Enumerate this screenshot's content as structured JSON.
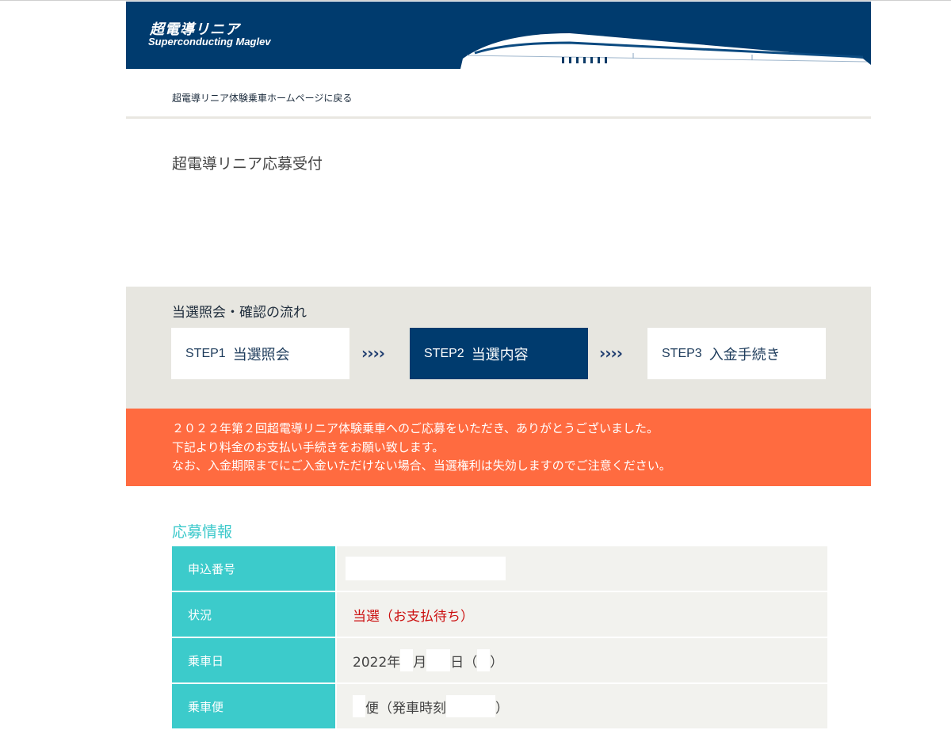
{
  "header": {
    "logo_ja": "超電導リニア",
    "logo_en": "Superconducting Maglev",
    "back_link": "超電導リニア体験乗車ホームページに戻る"
  },
  "page_title": "超電導リニア応募受付",
  "steps": {
    "heading": "当選照会・確認の流れ",
    "arrows": "››››",
    "items": [
      {
        "no": "STEP1",
        "label": "当選照会",
        "active": false
      },
      {
        "no": "STEP2",
        "label": "当選内容",
        "active": true
      },
      {
        "no": "STEP3",
        "label": "入金手続き",
        "active": false
      }
    ]
  },
  "notice": {
    "lines": [
      "２０２２年第２回超電導リニア体験乗車へのご応募をいただき、ありがとうございました。",
      "下記より料金のお支払い手続きをお願い致します。",
      "なお、入金期限までにご入金いただけない場合、当選権利は失効しますのでご注意ください。"
    ]
  },
  "info": {
    "heading": "応募情報",
    "rows": {
      "application_no": {
        "label": "申込番号",
        "value": ""
      },
      "status": {
        "label": "状況",
        "value": "当選（お支払待ち）"
      },
      "boarding_date": {
        "label": "乗車日",
        "year": "2022年",
        "month_unit": "月",
        "day_unit": "日（",
        "close": "）"
      },
      "train": {
        "label": "乗車便",
        "unit": "便（発車時刻",
        "close": "）"
      }
    }
  },
  "colors": {
    "header_navy": "#003b6e",
    "teal": "#3ccbcb",
    "notice_orange": "#ff6b40",
    "status_red": "#cc1111"
  }
}
